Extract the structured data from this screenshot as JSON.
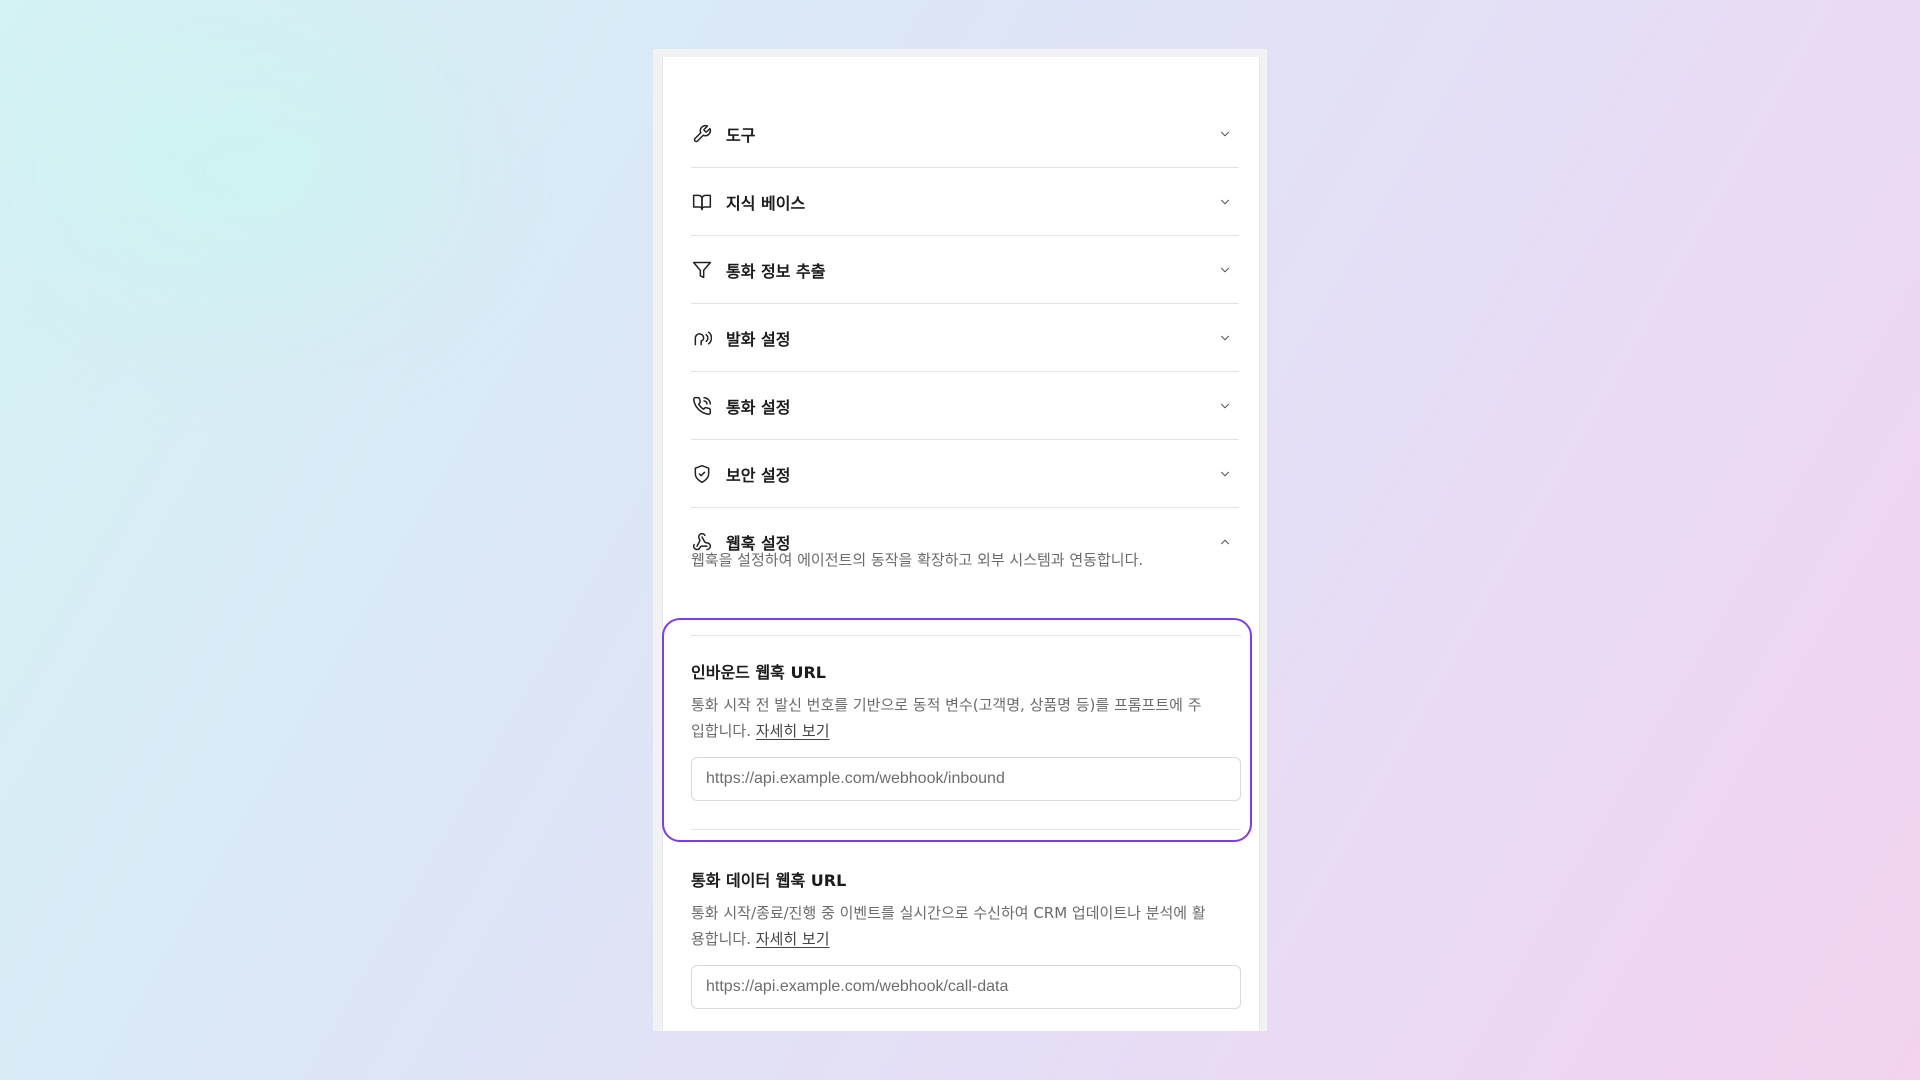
{
  "accordion": {
    "items": [
      {
        "label": "도구",
        "icon": "wrench-icon",
        "expanded": false
      },
      {
        "label": "지식 베이스",
        "icon": "book-open-icon",
        "expanded": false
      },
      {
        "label": "통화 정보 추출",
        "icon": "filter-icon",
        "expanded": false
      },
      {
        "label": "발화 설정",
        "icon": "speech-icon",
        "expanded": false
      },
      {
        "label": "통화 설정",
        "icon": "phone-call-icon",
        "expanded": false
      },
      {
        "label": "보안 설정",
        "icon": "shield-check-icon",
        "expanded": false
      },
      {
        "label": "웹훅 설정",
        "icon": "webhook-icon",
        "expanded": true
      }
    ]
  },
  "webhook": {
    "description": "웹훅을 설정하여 에이전트의 동작을 확장하고 외부 시스템과 연동합니다.",
    "inbound": {
      "title": "인바운드 웹훅 URL",
      "desc_line1": "통화 시작 전 발신 번호를 기반으로 동적 변수(고객명, 상품명 등)를 프롬프트에 주",
      "desc_line2": "입합니다.",
      "link": "자세히 보기",
      "placeholder": "https://api.example.com/webhook/inbound",
      "value": ""
    },
    "call_data": {
      "title": "통화 데이터 웹훅 URL",
      "desc_line1": "통화 시작/종료/진행 중 이벤트를 실시간으로 수신하여 CRM 업데이트나 분석에 활",
      "desc_line2": "용합니다.",
      "link": "자세히 보기",
      "placeholder": "https://api.example.com/webhook/call-data",
      "value": ""
    }
  },
  "colors": {
    "highlight": "#7b3fe4",
    "divider": "#e3e3e6",
    "muted_text": "#6b6b6b"
  }
}
